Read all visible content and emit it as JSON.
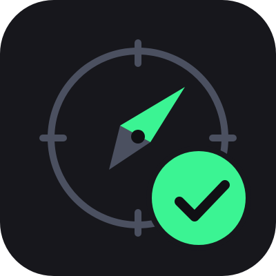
{
  "app_icon": {
    "name": "compass-check-app-icon",
    "colors": {
      "background": "#17171C",
      "ring": "#4B5060",
      "needle_accent": "#3BF493",
      "needle_dark": "#4B5060",
      "pivot": "#101014",
      "check_badge": "#3BF493",
      "check_mark": "#101014"
    },
    "icons": {
      "compass": "compass-icon",
      "needle": "compass-needle-icon",
      "badge": "check-badge-icon",
      "check": "checkmark-icon"
    }
  }
}
